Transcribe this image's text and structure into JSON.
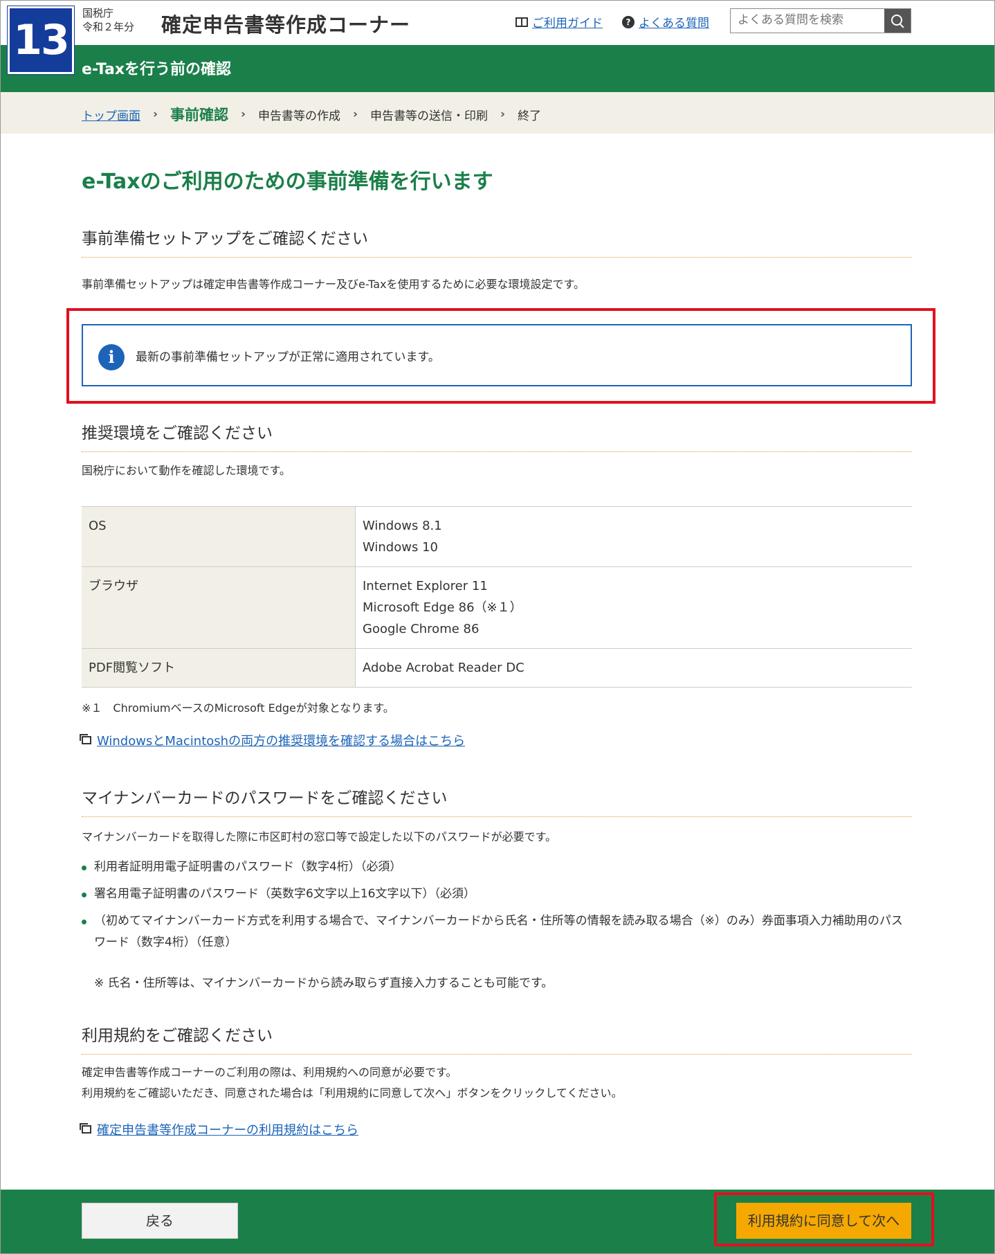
{
  "header": {
    "badge": "13",
    "agency": "国税庁",
    "year": "令和２年分",
    "title": "確定申告書等作成コーナー",
    "guide_link": "ご利用ガイド",
    "faq_link": "よくある質問",
    "search_placeholder": "よくある質問を検索"
  },
  "section_bar": {
    "title": "e-Taxを行う前の確認"
  },
  "breadcrumb": {
    "items": [
      "トップ画面",
      "事前確認",
      "申告書等の作成",
      "申告書等の送信・印刷",
      "終了"
    ]
  },
  "main": {
    "heading": "e-Taxのご利用のための事前準備を行います",
    "setup": {
      "heading": "事前準備セットアップをご確認ください",
      "description": "事前準備セットアップは確定申告書等作成コーナー及びe-Taxを使用するために必要な環境設定です。",
      "info_message": "最新の事前準備セットアップが正常に適用されています。"
    },
    "env": {
      "heading": "推奨環境をご確認ください",
      "description": "国税庁において動作を確認した環境です。",
      "rows": [
        {
          "key": "OS",
          "values": [
            "Windows 8.1",
            "Windows 10"
          ]
        },
        {
          "key": "ブラウザ",
          "values": [
            "Internet Explorer 11",
            "Microsoft Edge 86（※１）",
            "Google Chrome 86"
          ]
        },
        {
          "key": "PDF閲覧ソフト",
          "values": [
            "Adobe Acrobat Reader DC"
          ]
        }
      ],
      "footnote": "※１　ChromiumベースのMicrosoft Edgeが対象となります。",
      "link": "WindowsとMacintoshの両方の推奨環境を確認する場合はこちら"
    },
    "mynumber": {
      "heading": "マイナンバーカードのパスワードをご確認ください",
      "description": "マイナンバーカードを取得した際に市区町村の窓口等で設定した以下のパスワードが必要です。",
      "bullets": [
        "利用者証明用電子証明書のパスワード（数字4桁）（必須）",
        "署名用電子証明書のパスワード（英数字6文字以上16文字以下）（必須）",
        "（初めてマイナンバーカード方式を利用する場合で、マイナンバーカードから氏名・住所等の情報を読み取る場合（※）のみ）券面事項入力補助用のパスワード（数字4桁）（任意）"
      ],
      "note": "※ 氏名・住所等は、マイナンバーカードから読み取らず直接入力することも可能です。"
    },
    "terms": {
      "heading": "利用規約をご確認ください",
      "line1": "確定申告書等作成コーナーのご利用の際は、利用規約への同意が必要です。",
      "line2": "利用規約をご確認いただき、同意された場合は「利用規約に同意して次へ」ボタンをクリックしてください。",
      "link": "確定申告書等作成コーナーの利用規約はこちら"
    }
  },
  "footer": {
    "back_label": "戻る",
    "next_label": "利用規約に同意して次へ"
  },
  "colors": {
    "brand_green": "#1b7f4a",
    "badge_blue": "#143c9b",
    "link_blue": "#1d64b8",
    "highlight_red": "#e0101e",
    "button_orange": "#f5a800"
  }
}
